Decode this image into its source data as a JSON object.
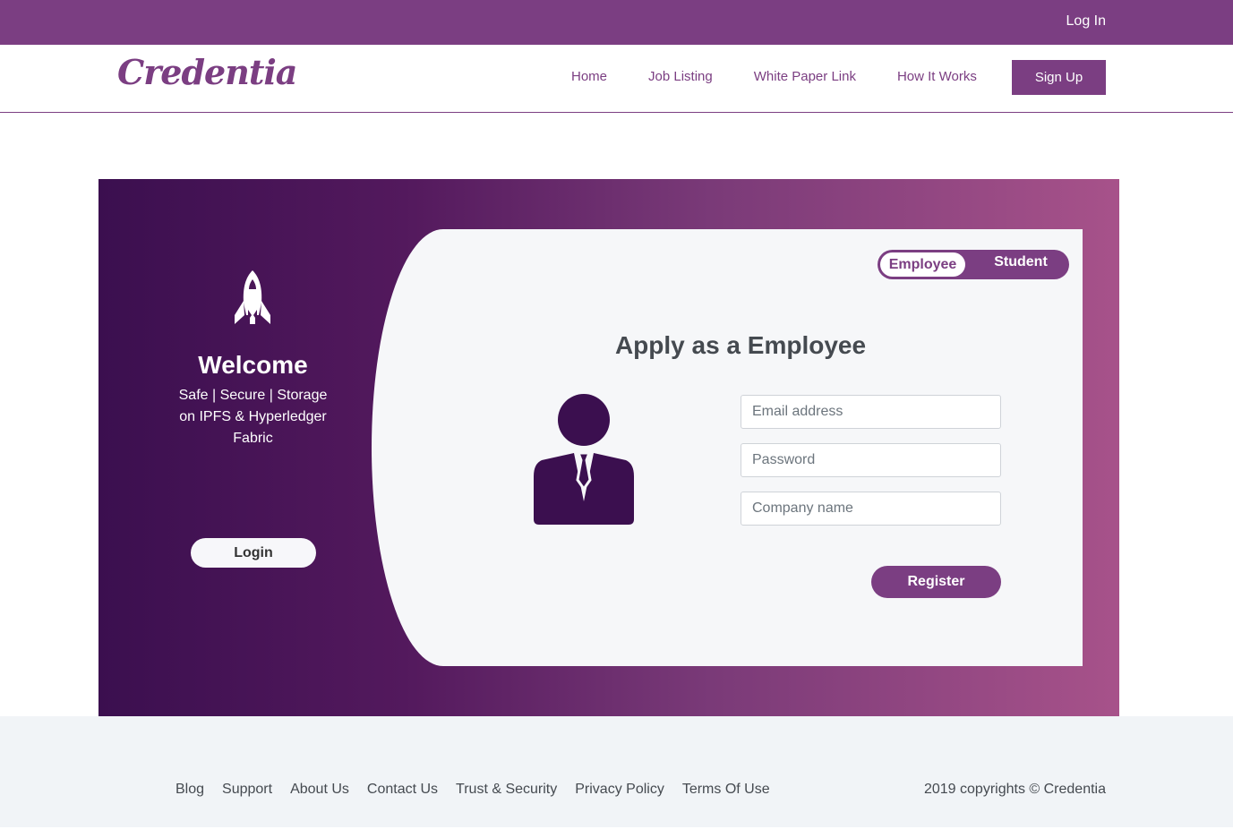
{
  "topbar": {
    "login_label": "Log In"
  },
  "navbar": {
    "brand": "Credentia",
    "links": [
      "Home",
      "Job Listing",
      "White Paper Link",
      "How It Works"
    ],
    "signup_label": "Sign Up"
  },
  "hero": {
    "left": {
      "icon": "rocket-icon",
      "welcome": "Welcome",
      "tagline": "Safe | Secure | Storage on IPFS & Hyperledger Fabric",
      "login_label": "Login"
    },
    "toggle": {
      "active": "Employee",
      "inactive": "Student"
    },
    "title": "Apply as a Employee",
    "avatar_icon": "employee-icon",
    "form": {
      "email_placeholder": "Email address",
      "password_placeholder": "Password",
      "company_placeholder": "Company name",
      "register_label": "Register"
    }
  },
  "footer": {
    "links": [
      "Blog",
      "Support",
      "About Us",
      "Contact Us",
      "Trust & Security",
      "Privacy Policy",
      "Terms Of Use"
    ],
    "copyright": "2019 copyrights © Credentia"
  },
  "colors": {
    "brand": "#7b3e82",
    "hero_start": "#3b0f4f",
    "hero_end": "#a7528a",
    "card_bg": "#f6f7f9",
    "footer_bg": "#f1f4f7"
  }
}
